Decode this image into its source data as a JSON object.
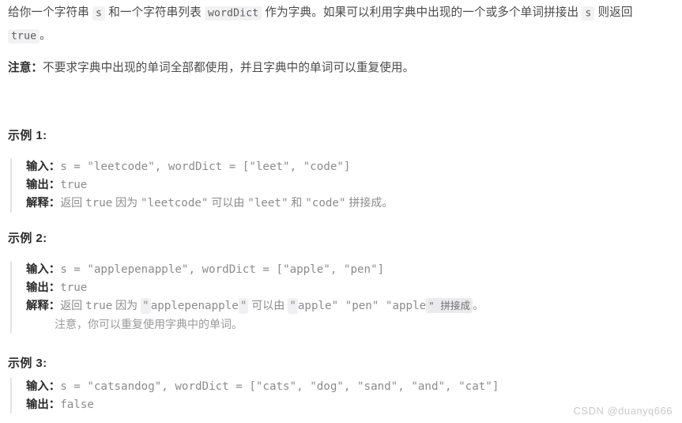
{
  "document": {
    "intro": {
      "seg1": "给你一个字符串 ",
      "code_s": "s",
      "seg2": " 和一个字符串列表 ",
      "code_worddict": "wordDict",
      "seg3": " 作为字典。如果可以利用字典中出现的一个或多个单词拼接出 ",
      "code_s2": "s",
      "seg4": " 则返回 ",
      "code_true": "true",
      "seg5": "。"
    },
    "note": {
      "label": "注意：",
      "text": "不要求字典中出现的单词全部都使用，并且字典中的单词可以重复使用。"
    },
    "examples": [
      {
        "heading": "示例 1:",
        "input_label": "输入：",
        "input_value": "s = \"leetcode\", wordDict = [\"leet\", \"code\"]",
        "output_label": "输出：",
        "output_value": "true",
        "explain_label": "解释：",
        "explain_parts": [
          {
            "kind": "cn",
            "text": "返回 "
          },
          {
            "kind": "mono",
            "text": "true"
          },
          {
            "kind": "cn",
            "text": " 因为 "
          },
          {
            "kind": "mono",
            "text": "\"leetcode\""
          },
          {
            "kind": "cn",
            "text": " 可以由 "
          },
          {
            "kind": "mono",
            "text": "\"leet\""
          },
          {
            "kind": "cn",
            "text": " 和 "
          },
          {
            "kind": "mono",
            "text": "\"code\""
          },
          {
            "kind": "cn",
            "text": " 拼接成。"
          }
        ],
        "sub_note": ""
      },
      {
        "heading": "示例 2:",
        "input_label": "输入：",
        "input_value": "s = \"applepenapple\", wordDict = [\"apple\", \"pen\"]",
        "output_label": "输出：",
        "output_value": "true",
        "explain_label": "解释：",
        "explain_parts": [
          {
            "kind": "cn",
            "text": "返回 "
          },
          {
            "kind": "mono",
            "text": "true"
          },
          {
            "kind": "cn",
            "text": " 因为 "
          },
          {
            "kind": "chip",
            "text": "\""
          },
          {
            "kind": "mono",
            "text": "applepenapple"
          },
          {
            "kind": "chip",
            "text": "\""
          },
          {
            "kind": "cn",
            "text": " 可以由 "
          },
          {
            "kind": "chip",
            "text": "\""
          },
          {
            "kind": "mono",
            "text": "apple\" \"pen\" \"apple"
          },
          {
            "kind": "hl",
            "text": "\" 拼接成"
          },
          {
            "kind": "cn",
            "text": "。"
          }
        ],
        "sub_note": "注意，你可以重复使用字典中的单词。"
      },
      {
        "heading": "示例 3:",
        "input_label": "输入：",
        "input_value": "s = \"catsandog\", wordDict = [\"cats\", \"dog\", \"sand\", \"and\", \"cat\"]",
        "output_label": "输出：",
        "output_value": "false",
        "explain_label": "",
        "explain_parts": [],
        "sub_note": ""
      }
    ],
    "watermark": "CSDN @duanyq666"
  }
}
